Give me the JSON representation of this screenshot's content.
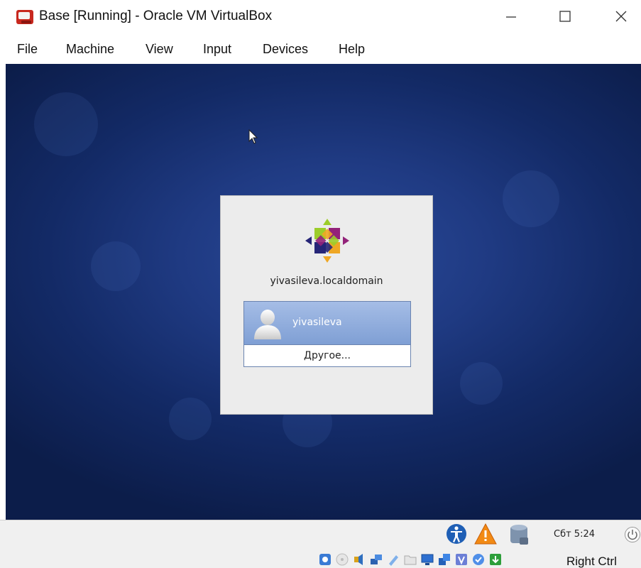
{
  "window": {
    "title": "Base [Running] - Oracle VM VirtualBox"
  },
  "menu": {
    "items": [
      "File",
      "Machine",
      "View",
      "Input",
      "Devices",
      "Help"
    ]
  },
  "login": {
    "hostname": "yivasileva.localdomain",
    "user": "yivasileva",
    "other": "Другое..."
  },
  "guest_panel": {
    "clock": "Сбт  5:24"
  },
  "statusbar": {
    "host_key": "Right Ctrl"
  },
  "colors": {
    "desktop": "#1f3a82",
    "selected_user": "#8aa7d9",
    "dialog": "#ececec"
  }
}
